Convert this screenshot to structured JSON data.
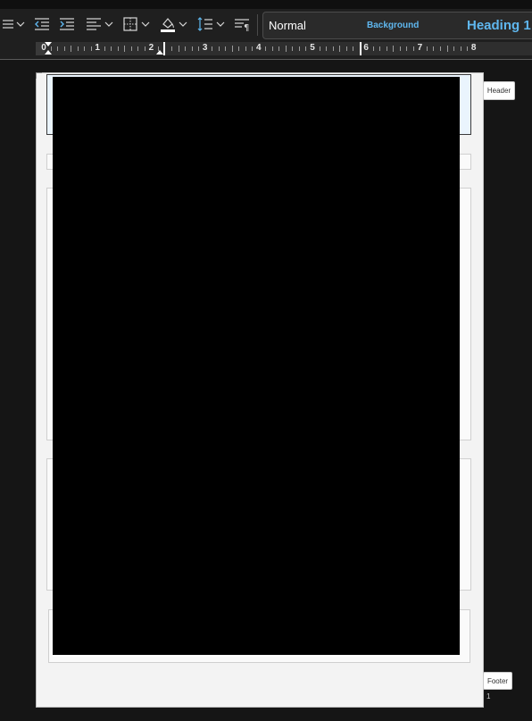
{
  "styles_gallery": {
    "items": [
      {
        "label": "Normal"
      },
      {
        "label": "Background"
      },
      {
        "label": "Heading 1"
      }
    ]
  },
  "ruler": {
    "numbers": [
      "0",
      "1",
      "2",
      "3",
      "4",
      "5",
      "6",
      "7",
      "8"
    ]
  },
  "document": {
    "header_label": "Header",
    "footer_label": "Footer",
    "page_number": "1"
  },
  "colors": {
    "accent": "#5fb7ef",
    "toolbar_bg": "#1f1f1f",
    "page_bg": "#f3f3f3",
    "header_region": "#eaf4fd"
  },
  "icons": [
    "bullets-icon",
    "decrease-indent-icon",
    "increase-indent-icon",
    "align-left-icon",
    "borders-icon",
    "shading-icon",
    "line-spacing-icon",
    "paragraph-mark-icon"
  ]
}
